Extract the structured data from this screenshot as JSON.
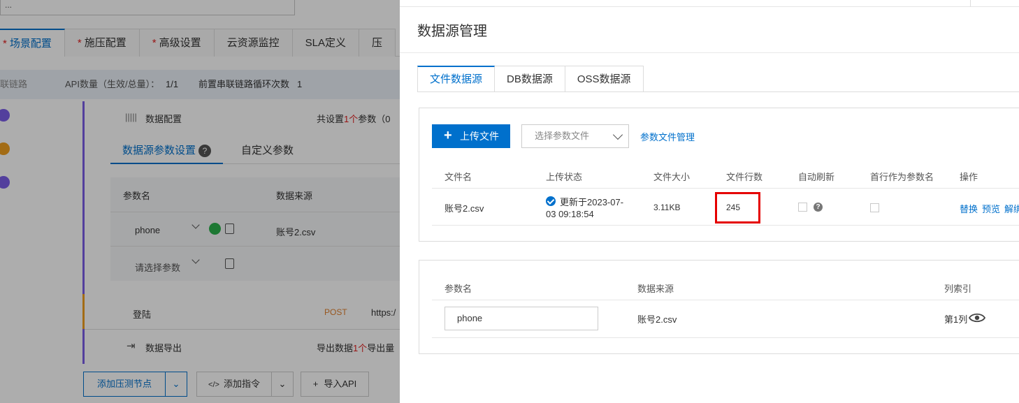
{
  "background": {
    "top_input_text": "...",
    "tabs": [
      {
        "label": "场景配置",
        "required": true,
        "active": true
      },
      {
        "label": "施压配置",
        "required": true,
        "active": false
      },
      {
        "label": "高级设置",
        "required": true,
        "active": false
      },
      {
        "label": "云资源监控",
        "required": false,
        "active": false
      },
      {
        "label": "SLA定义",
        "required": false,
        "active": false
      },
      {
        "label": "压",
        "required": false,
        "active": false
      }
    ],
    "info_bar": {
      "link_label": "联链路",
      "api_count_label": "API数量（生效/总量）：",
      "api_count_value": "1/1",
      "loop_label": "前置串联链路循环次数",
      "loop_value": "1"
    },
    "data_config": {
      "label": "数据配置",
      "summary_prefix": "共设置",
      "summary_count": "1个",
      "summary_suffix": "参数（0"
    },
    "subtabs": {
      "source_params": "数据源参数设置",
      "custom_params": "自定义参数"
    },
    "param_table": {
      "col_name": "参数名",
      "col_source": "数据来源",
      "row1_name": "phone",
      "row1_source": "账号2.csv",
      "row2_placeholder": "请选择参数"
    },
    "login_row": {
      "name": "登陆",
      "method": "POST",
      "url": "https:/"
    },
    "export_row": {
      "label": "数据导出",
      "summary_prefix": "导出数据",
      "summary_count": "1个",
      "summary_suffix": "导出量"
    },
    "buttons": {
      "add_node": "添加压测节点",
      "add_cmd": "添加指令",
      "import_api": "导入API"
    }
  },
  "drawer": {
    "title": "数据源管理",
    "tabs": [
      {
        "label": "文件数据源",
        "active": true
      },
      {
        "label": "DB数据源",
        "active": false
      },
      {
        "label": "OSS数据源",
        "active": false
      }
    ],
    "upload_button": "上传文件",
    "select_placeholder": "选择参数文件",
    "manage_link": "参数文件管理",
    "file_table": {
      "headers": [
        "文件名",
        "上传状态",
        "文件大小",
        "文件行数",
        "自动刷新",
        "首行作为参数名",
        "操作"
      ],
      "rows": [
        {
          "file_name": "账号2.csv",
          "status_line1": "更新于2023-07-",
          "status_line2": "03 09:18:54",
          "size": "3.11KB",
          "rows": "245",
          "auto_refresh": false,
          "first_row_header": false,
          "actions": [
            "替换",
            "预览",
            "解绑"
          ]
        }
      ]
    },
    "param_table": {
      "headers": [
        "参数名",
        "数据来源",
        "列索引"
      ],
      "rows": [
        {
          "name": "phone",
          "source": "账号2.csv",
          "column": "第1列"
        }
      ]
    }
  },
  "colors": {
    "primary": "#0070cc",
    "highlight_border": "#e50000",
    "timeline_purple": "#7b5ee8",
    "timeline_orange": "#f0a020",
    "success_green": "#2bb24c"
  }
}
